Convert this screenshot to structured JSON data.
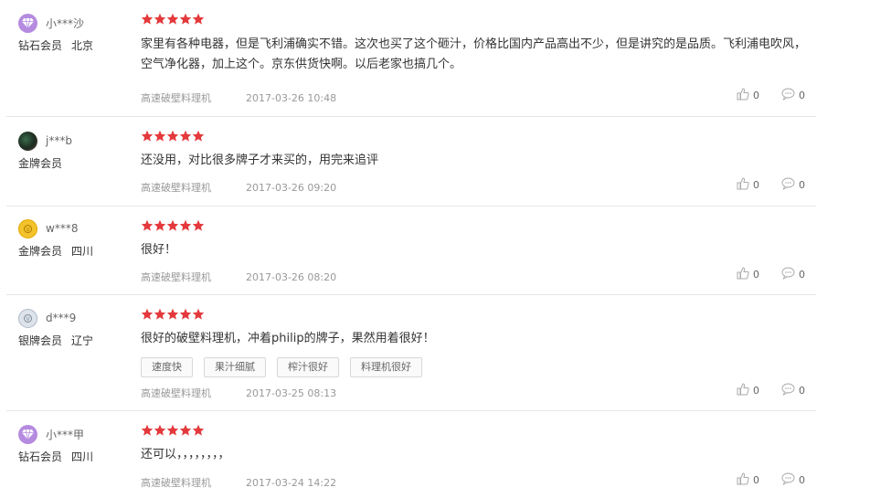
{
  "reviews": [
    {
      "nickname": "小***沙",
      "level": "钻石会员",
      "location": "北京",
      "avatar": "diamond-badge-icon",
      "stars": 5,
      "content": "家里有各种电器，但是飞利浦确实不错。这次也买了这个砸汁，价格比国内产品高出不少，但是讲究的是品质。飞利浦电吹风，空气净化器，加上这个。京东供货快啊。以后老家也搞几个。",
      "tags": [],
      "product": "高速破壁料理机",
      "date": "2017-03-26 10:48",
      "likes": "0",
      "replies": "0"
    },
    {
      "nickname": "j***b",
      "level": "金牌会员",
      "location": "",
      "avatar": "user-photo-avatar",
      "stars": 5,
      "content": "还没用，对比很多牌子才来买的，用完来追评",
      "tags": [],
      "product": "高速破壁料理机",
      "date": "2017-03-26 09:20",
      "likes": "0",
      "replies": "0"
    },
    {
      "nickname": "w***8",
      "level": "金牌会员",
      "location": "四川",
      "avatar": "gold-badge-icon",
      "stars": 5,
      "content": "很好！",
      "tags": [],
      "product": "高速破壁料理机",
      "date": "2017-03-26 08:20",
      "likes": "0",
      "replies": "0"
    },
    {
      "nickname": "d***9",
      "level": "银牌会员",
      "location": "辽宁",
      "avatar": "silver-badge-icon",
      "stars": 5,
      "content": "很好的破壁料理机，冲着philip的牌子，果然用着很好！",
      "tags": [
        "速度快",
        "果汁细腻",
        "榨汁很好",
        "料理机很好"
      ],
      "product": "高速破壁料理机",
      "date": "2017-03-25 08:13",
      "likes": "0",
      "replies": "0"
    },
    {
      "nickname": "小***甲",
      "level": "钻石会员",
      "location": "四川",
      "avatar": "diamond-badge-icon",
      "stars": 5,
      "content": "还可以，，，，，，，，",
      "tags": [],
      "product": "高速破壁料理机",
      "date": "2017-03-24 14:22",
      "likes": "0",
      "replies": "0"
    }
  ],
  "colors": {
    "star": "#e4393c",
    "meta": "#999999",
    "divider": "#e6e6e6"
  }
}
